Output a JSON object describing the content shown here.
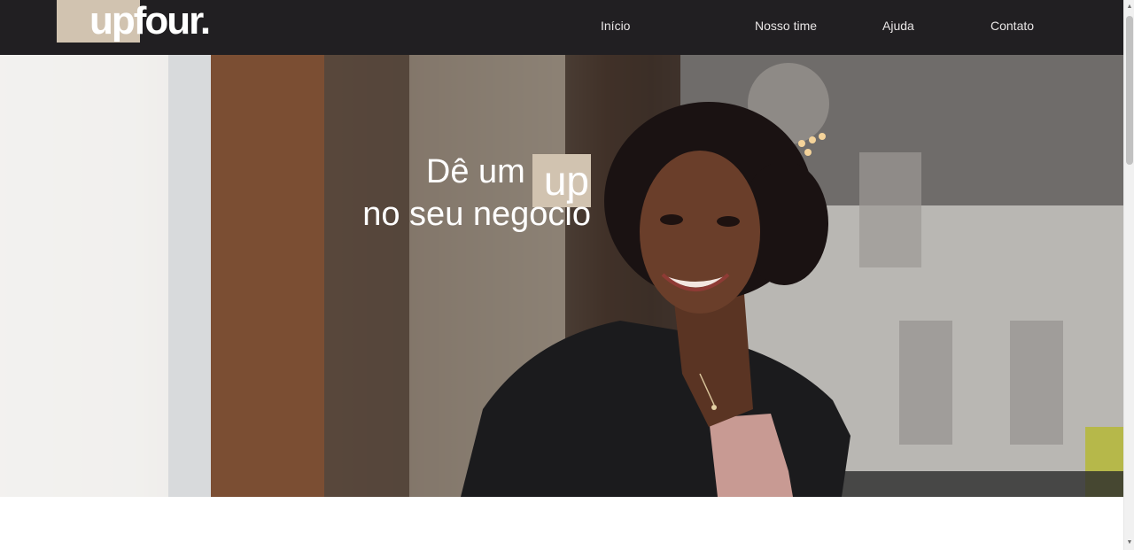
{
  "header": {
    "logo_text": "upfour.",
    "nav": [
      {
        "label": "Início"
      },
      {
        "label": "Nosso time"
      },
      {
        "label": "Ajuda"
      },
      {
        "label": "Contato"
      }
    ]
  },
  "hero": {
    "headline_prefix": "Dê um",
    "headline_highlight": "up",
    "headline_line2": "no seu negocio",
    "image_description": "smiling-businesswoman-photo"
  },
  "colors": {
    "header_bg": "#211f22",
    "accent": "#d1c3b0",
    "nav_text": "#e9e6e6"
  },
  "scrollbar": {
    "up_arrow": "▲",
    "down_arrow": "▼"
  }
}
